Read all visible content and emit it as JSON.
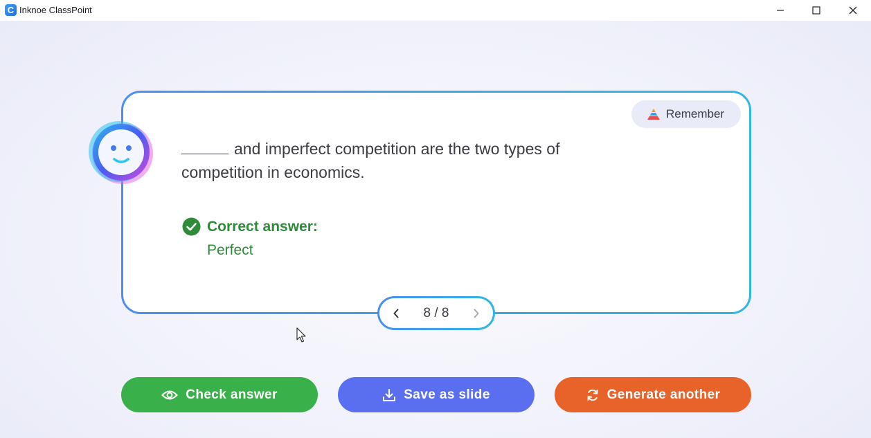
{
  "window": {
    "app_icon_letter": "C",
    "title": "Inknoe ClassPoint",
    "controls": [
      "minimize-icon",
      "maximize-icon",
      "close-icon"
    ]
  },
  "card": {
    "bloom_level": {
      "icon": "pyramid-icon",
      "label": "Remember"
    },
    "question_text": "and imperfect competition are the two types of competition in economics.",
    "correct_answer": {
      "icon": "check-circle-icon",
      "heading": "Correct answer:",
      "value": "Perfect"
    },
    "avatar": "smiley-face-avatar"
  },
  "pager": {
    "label": "8 / 8",
    "current": 8,
    "total": 8
  },
  "actions": {
    "check_answer": {
      "icon": "eye-icon",
      "label": "Check answer"
    },
    "save_as_slide": {
      "icon": "download-icon",
      "label": "Save as slide"
    },
    "generate_another": {
      "icon": "refresh-icon",
      "label": "Generate another"
    }
  },
  "colors": {
    "card_border_start": "#4a8ef0",
    "card_border_end": "#2fb7e8",
    "answer_green": "#2e8b3a",
    "check_button": "#39b04a",
    "save_button": "#5a6ff0",
    "generate_button": "#e8632a",
    "badge_bg": "#e9ecf8"
  }
}
